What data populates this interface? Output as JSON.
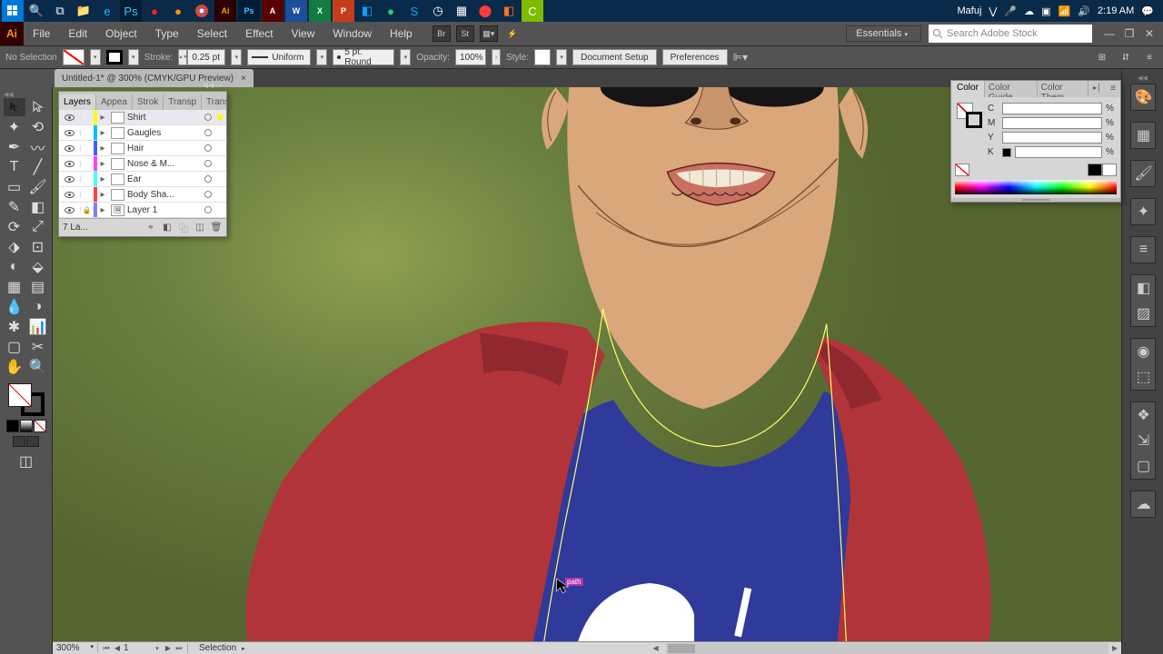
{
  "taskbar": {
    "user": "Mafuj",
    "time": "2:19 AM"
  },
  "menu": {
    "items": [
      "File",
      "Edit",
      "Object",
      "Type",
      "Select",
      "Effect",
      "View",
      "Window",
      "Help"
    ]
  },
  "workspace": {
    "selected": "Essentials"
  },
  "stock": {
    "placeholder": "Search Adobe Stock"
  },
  "control": {
    "selection": "No Selection",
    "strokeLabel": "Stroke:",
    "strokeWeight": "0.25 pt",
    "strokeProfile": "Uniform",
    "brush": "5 pt. Round",
    "opacityLabel": "Opacity:",
    "opacity": "100%",
    "styleLabel": "Style:",
    "docSetup": "Document Setup",
    "prefs": "Preferences"
  },
  "document": {
    "tabTitle": "Untitled-1* @ 300% (CMYK/GPU Preview)"
  },
  "layersPanel": {
    "tabs": [
      "Layers",
      "Appea",
      "Strok",
      "Transp",
      "Transf"
    ],
    "footer": "7 La...",
    "layers": [
      {
        "name": "Shirt",
        "color": "#ffff00",
        "selected": true
      },
      {
        "name": "Gaugles",
        "color": "#00c0ff"
      },
      {
        "name": "Hair",
        "color": "#4060ff"
      },
      {
        "name": "Nose & M...",
        "color": "#ff40ff"
      },
      {
        "name": "Ear",
        "color": "#40ffff"
      },
      {
        "name": "Body Sha...",
        "color": "#ff4040"
      },
      {
        "name": "Layer 1",
        "color": "#8080ff",
        "locked": true,
        "img": true
      }
    ]
  },
  "colorPanel": {
    "tabs": [
      "Color",
      "Color Guide",
      "Color Them"
    ],
    "channels": [
      "C",
      "M",
      "Y",
      "K"
    ],
    "unit": "%"
  },
  "status": {
    "zoom": "300%",
    "artboard": "1",
    "tool": "Selection"
  },
  "canvas": {
    "pathHint": "path"
  }
}
